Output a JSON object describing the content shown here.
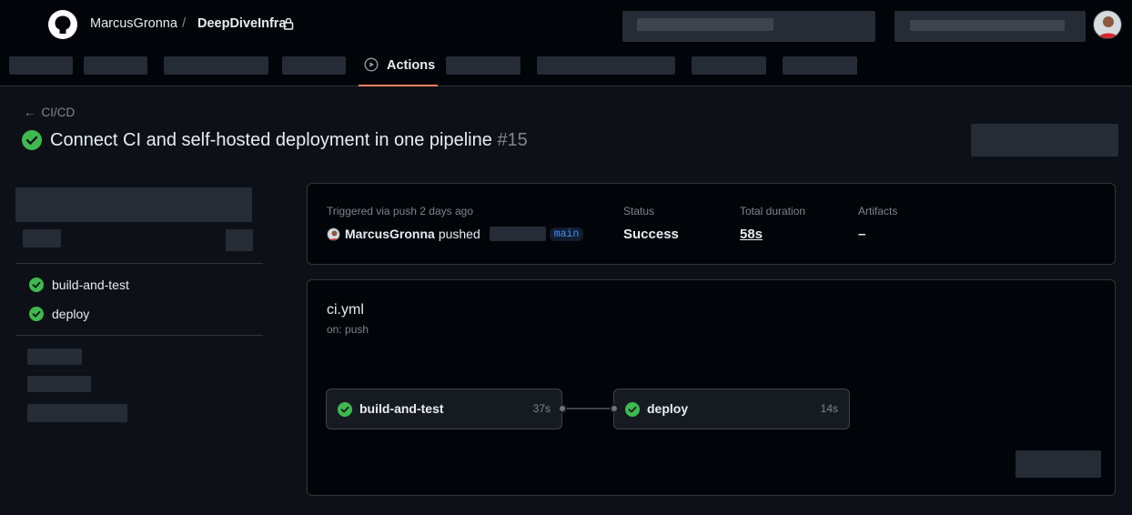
{
  "header": {
    "owner": "MarcusGronna",
    "separator": "/",
    "repo": "DeepDiveInfra"
  },
  "nav": {
    "active_tab": "Actions"
  },
  "breadcrumb": {
    "back_label": "CI/CD"
  },
  "run": {
    "title": "Connect CI and self-hosted deployment in one pipeline",
    "number": "#15"
  },
  "sidebar": {
    "jobs": [
      {
        "label": "build-and-test"
      },
      {
        "label": "deploy"
      }
    ]
  },
  "summary": {
    "triggered_label": "Triggered via push 2 days ago",
    "actor": "MarcusGronna",
    "action": "pushed",
    "branch": "main",
    "status_label": "Status",
    "status_value": "Success",
    "duration_label": "Total duration",
    "duration_value": "58s",
    "artifacts_label": "Artifacts",
    "artifacts_value": "–"
  },
  "workflow": {
    "file": "ci.yml",
    "trigger": "on: push",
    "jobs": [
      {
        "name": "build-and-test",
        "time": "37s"
      },
      {
        "name": "deploy",
        "time": "14s"
      }
    ]
  },
  "colors": {
    "success": "#3fb950",
    "tab_underline": "#f78166",
    "branch_text": "#4493f8"
  },
  "icons": [
    "github-logo-icon",
    "lock-icon",
    "play-icon",
    "arrow-left-icon",
    "check-circle-icon"
  ]
}
